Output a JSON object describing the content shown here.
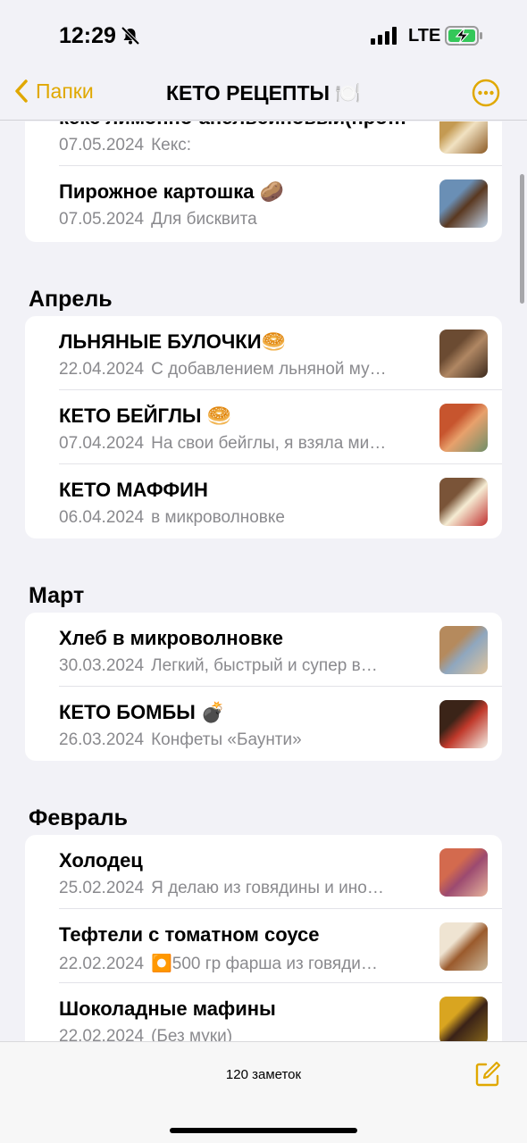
{
  "status": {
    "time": "12:29",
    "network": "LTE"
  },
  "nav": {
    "back_label": "Папки",
    "title": "КЕТО РЕЦЕПТЫ 🍽️"
  },
  "colors": {
    "accent": "#e0a800",
    "background": "#f2f2f7",
    "secondary_text": "#8a8a8e"
  },
  "sections": [
    {
      "header": "",
      "notes": [
        {
          "title": "кекс лимонно-апельсиновый(про…",
          "date": "07.05.2024",
          "preview": "Кекс:",
          "thumb": [
            "#c49a52",
            "#f1e2c2",
            "#8c5a24"
          ]
        },
        {
          "title": "Пирожное картошка 🥔",
          "date": "07.05.2024",
          "preview": "Для бисквита",
          "thumb": [
            "#6a8fb5",
            "#5a3820",
            "#c0d3e8"
          ]
        }
      ]
    },
    {
      "header": "Апрель",
      "notes": [
        {
          "title": "ЛЬНЯНЫЕ БУЛОЧКИ🥯",
          "date": "22.04.2024",
          "preview": "С добавлением льняной му…",
          "thumb": [
            "#6b4b32",
            "#b08763",
            "#3c2a1d"
          ]
        },
        {
          "title": "КЕТО БЕЙГЛЫ 🥯",
          "date": "07.04.2024",
          "preview": "На свои бейглы, я взяла ми…",
          "thumb": [
            "#c7552e",
            "#e8a16c",
            "#6f8f6a"
          ]
        },
        {
          "title": "КЕТО МАФФИН",
          "date": "06.04.2024",
          "preview": "в микроволновке",
          "thumb": [
            "#7a5438",
            "#f5ecd3",
            "#c03030"
          ]
        }
      ]
    },
    {
      "header": "Март",
      "notes": [
        {
          "title": "Хлеб в микроволновке",
          "date": "30.03.2024",
          "preview": "Легкий, быстрый и супер в…",
          "thumb": [
            "#b58a5d",
            "#8fa7bf",
            "#e1c49c"
          ]
        },
        {
          "title": "КЕТО БОМБЫ 💣",
          "date": "26.03.2024",
          "preview": "Конфеты «Баунти»",
          "thumb": [
            "#3b2418",
            "#c0392b",
            "#f4efe6"
          ]
        }
      ]
    },
    {
      "header": "Февраль",
      "notes": [
        {
          "title": "Холодец",
          "date": "25.02.2024",
          "preview": "Я делаю из говядины и ино…",
          "thumb": [
            "#d36a4e",
            "#9c4a70",
            "#e7b59d"
          ]
        },
        {
          "title": "Тефтели с томатном соусе",
          "date": "22.02.2024",
          "preview": "⏺️500 гр фарша из говяди…",
          "thumb": [
            "#efe4d2",
            "#9a5a2c",
            "#c9b79a"
          ]
        },
        {
          "title": "Шоколадные мафины",
          "date": "22.02.2024",
          "preview": "(Без муки)",
          "thumb": [
            "#d9a520",
            "#3a2218",
            "#8a6a1a"
          ]
        }
      ]
    }
  ],
  "footer": {
    "count": "120 заметок"
  }
}
